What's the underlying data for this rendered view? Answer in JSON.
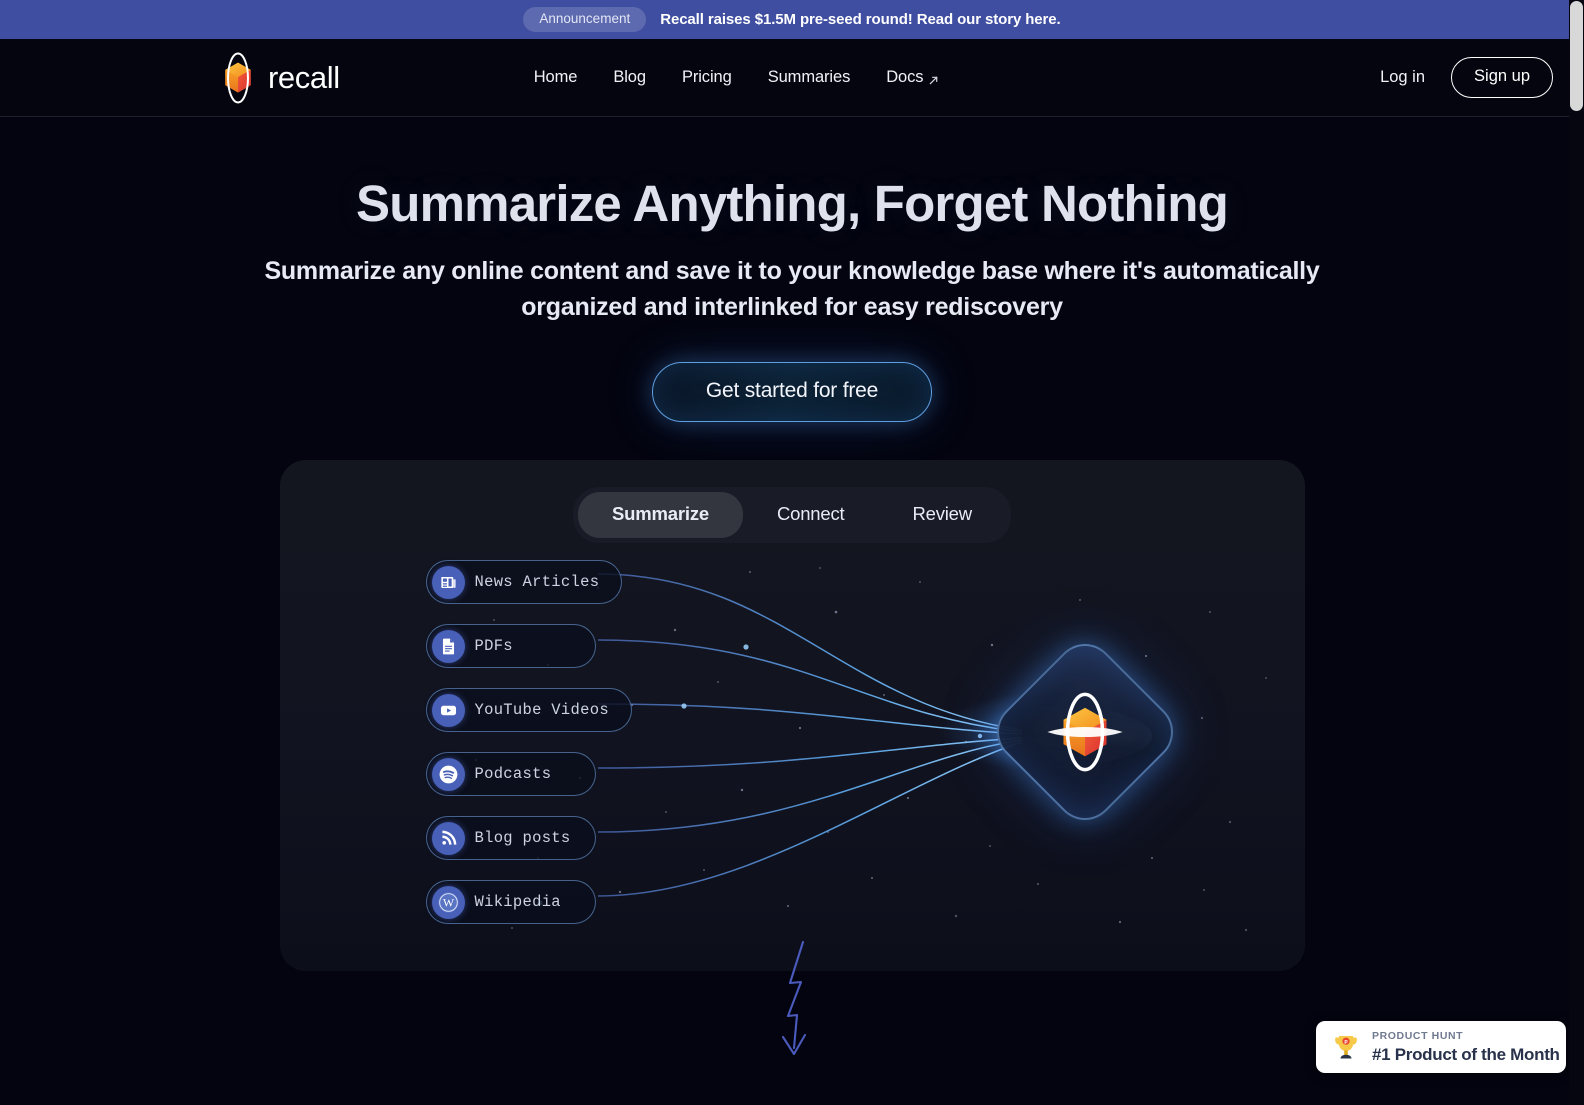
{
  "announcement": {
    "badge": "Announcement",
    "message": "Recall raises $1.5M pre-seed round! Read our story here.",
    "bar_color": "#3f4ea0"
  },
  "header": {
    "brand": "recall",
    "nav": [
      {
        "label": "Home",
        "external": false
      },
      {
        "label": "Blog",
        "external": false
      },
      {
        "label": "Pricing",
        "external": false
      },
      {
        "label": "Summaries",
        "external": false
      },
      {
        "label": "Docs",
        "external": true
      }
    ],
    "login_label": "Log in",
    "signup_label": "Sign up"
  },
  "hero": {
    "title": "Summarize Anything, Forget Nothing",
    "subtitle": "Summarize any online content and save it to your knowledge base where it's automatically organized and interlinked for easy rediscovery",
    "cta_label": "Get started for free",
    "cta_accent": "#5f9fe0"
  },
  "showcase": {
    "tabs": [
      {
        "label": "Summarize",
        "active": true
      },
      {
        "label": "Connect",
        "active": false
      },
      {
        "label": "Review",
        "active": false
      }
    ],
    "sources": [
      {
        "label": "News Articles",
        "icon": "newspaper-icon"
      },
      {
        "label": "PDFs",
        "icon": "document-icon"
      },
      {
        "label": "YouTube Videos",
        "icon": "youtube-icon"
      },
      {
        "label": "Podcasts",
        "icon": "spotify-icon"
      },
      {
        "label": "Blog posts",
        "icon": "rss-icon"
      },
      {
        "label": "Wikipedia",
        "icon": "wikipedia-icon"
      }
    ],
    "node_icon": "recall-logo-icon",
    "chip_border_color": "#78aaeb",
    "chip_icon_color": "#4860b8"
  },
  "scroll_cue": {
    "icon": "zigzag-down-arrow-icon"
  },
  "product_hunt": {
    "kicker": "PRODUCT HUNT",
    "title": "#1 Product of the Month",
    "icon": "trophy-icon"
  }
}
